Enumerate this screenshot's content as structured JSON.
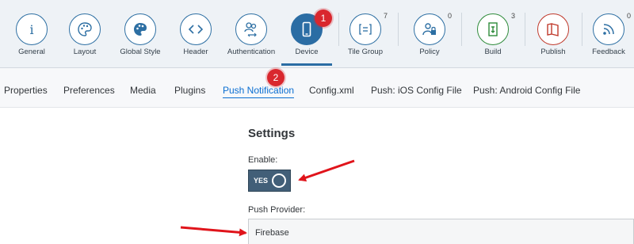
{
  "toolbar": {
    "items": [
      {
        "label": "General",
        "icon": "info-icon"
      },
      {
        "label": "Layout",
        "icon": "palette-icon"
      },
      {
        "label": "Global Style",
        "icon": "palette-filled-icon"
      },
      {
        "label": "Header",
        "icon": "code-icon"
      },
      {
        "label": "Authentication",
        "icon": "users-icon"
      },
      {
        "label": "Device",
        "icon": "phone-icon",
        "active": true
      },
      {
        "label": "Tile Group",
        "icon": "tile-group-icon",
        "count": "7"
      },
      {
        "label": "Policy",
        "icon": "user-lock-icon",
        "count": "0"
      },
      {
        "label": "Build",
        "icon": "build-icon",
        "count": "3"
      },
      {
        "label": "Publish",
        "icon": "publish-icon"
      },
      {
        "label": "Feedback",
        "icon": "feedback-icon",
        "count": "0"
      }
    ]
  },
  "callouts": {
    "one": "1",
    "two": "2"
  },
  "subtabs": [
    "Properties",
    "Preferences",
    "Media",
    "Plugins",
    "Push Notification",
    "Config.xml",
    "Push: iOS Config File",
    "Push: Android Config File"
  ],
  "settings": {
    "heading": "Settings",
    "enable_label": "Enable:",
    "toggle_text": "YES",
    "provider_label": "Push Provider:",
    "provider_value": "Firebase"
  },
  "colors": {
    "accent": "#2b6da4",
    "build": "#2e8b3a",
    "publish": "#c0392b",
    "callout": "#d9272e"
  }
}
